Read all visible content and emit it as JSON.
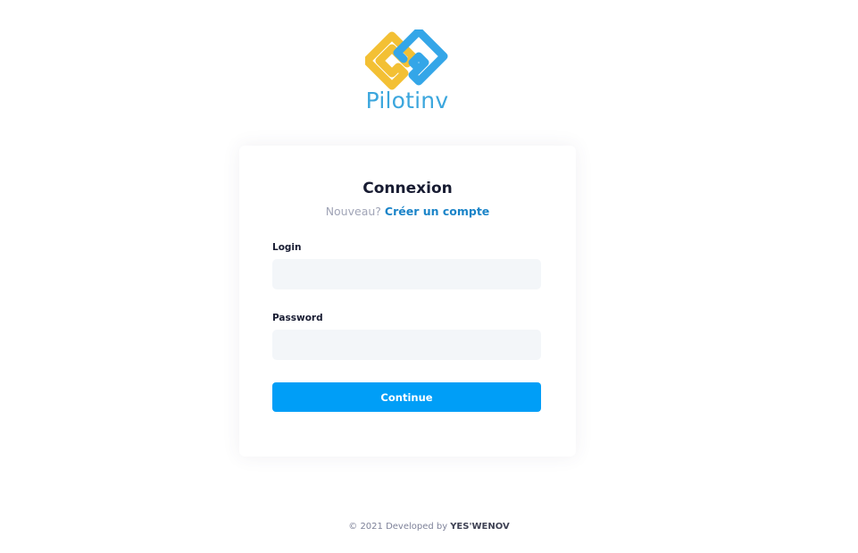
{
  "brand": {
    "name": "Pilotinv",
    "colors": {
      "yellow": "#f3c034",
      "blue": "#34a6e8",
      "text": "#3ba6dd"
    }
  },
  "card": {
    "title": "Connexion",
    "subtitle_prefix": "Nouveau?",
    "signup_link": "Créer un compte"
  },
  "form": {
    "login_label": "Login",
    "login_value": "",
    "password_label": "Password",
    "password_value": "",
    "submit_label": "Continue"
  },
  "footer": {
    "text": "© 2021 Developed by",
    "company": "YES'WENOV"
  },
  "colors": {
    "primary": "#009ef7",
    "input_bg": "#f3f6f9",
    "link": "#1b84c8"
  }
}
